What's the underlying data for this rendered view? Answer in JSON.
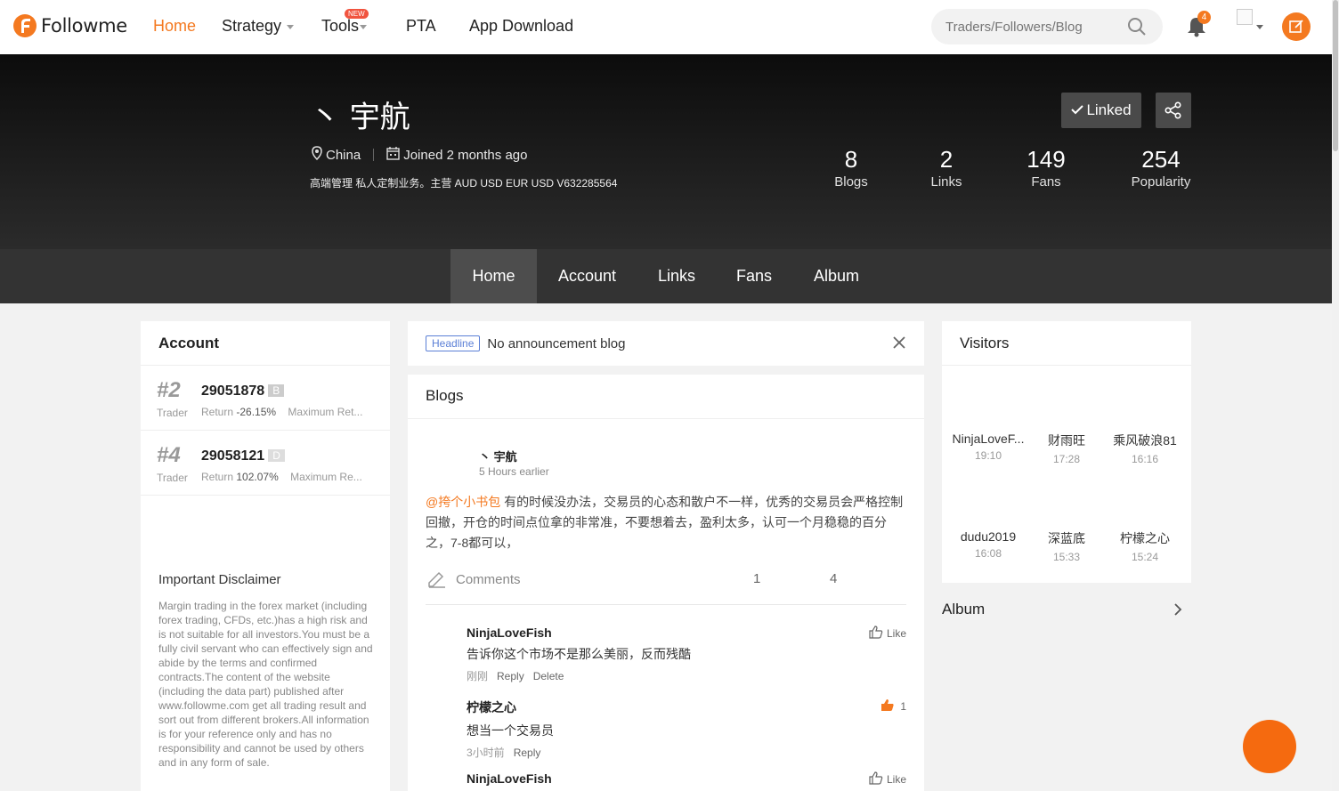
{
  "app": {
    "logo_text": "Followme",
    "brand_color": "#f47920"
  },
  "nav": {
    "items": [
      {
        "label": "Home",
        "active": true
      },
      {
        "label": "Strategy",
        "dropdown": true
      },
      {
        "label": "Tools",
        "dropdown": true,
        "badge": "NEW"
      },
      {
        "label": "PTA"
      },
      {
        "label": "App Download"
      }
    ],
    "search_placeholder": "Traders/Followers/Blog",
    "notification_count": "4"
  },
  "profile": {
    "name": "丶 宇航",
    "location": "China",
    "joined": "Joined 2 months ago",
    "bio": "高端管理 私人定制业务。主营 AUD USD EUR USD V632285564",
    "linked_label": "Linked",
    "stats": [
      {
        "value": "8",
        "label": "Blogs"
      },
      {
        "value": "2",
        "label": "Links"
      },
      {
        "value": "149",
        "label": "Fans"
      },
      {
        "value": "254",
        "label": "Popularity"
      }
    ]
  },
  "tabs": [
    "Home",
    "Account",
    "Links",
    "Fans",
    "Album"
  ],
  "account": {
    "title": "Account",
    "rows": [
      {
        "rank": "#2",
        "number": "29051878",
        "badge": "B",
        "type": "Trader",
        "return_label": "Return",
        "return_value": "-26.15%",
        "extra": "Maximum Ret..."
      },
      {
        "rank": "#4",
        "number": "29058121",
        "badge": "D",
        "type": "Trader",
        "return_label": "Return",
        "return_value": "102.07%",
        "extra": "Maximum Re..."
      }
    ],
    "disclaimer_title": "Important Disclaimer",
    "disclaimer_text": "Margin trading in the forex market (including forex trading, CFDs, etc.)has a high risk and is not suitable for all investors.You must be a fully civil servant who can effectively sign and abide by the terms and confirmed contracts.The content of the website (including the data part) published after www.followme.com get all trading result and sort out from different brokers.All information is for your reference only and has no responsibility and cannot be used by others and in any form of sale."
  },
  "announcement": {
    "tag": "Headline",
    "text": "No announcement blog"
  },
  "blogs": {
    "title": "Blogs",
    "post": {
      "author": "丶 宇航",
      "time": "5 Hours earlier",
      "mention": "@挎个小书包",
      "body": " 有的时候没办法，交易员的心态和散户不一样，优秀的交易员会严格控制回撤，开仓的时间点位拿的非常准，不要想着去，盈利太多，认可一个月稳稳的百分之，7-8都可以，",
      "comments_label": "Comments",
      "count_a": "1",
      "count_b": "4"
    },
    "comments": [
      {
        "name": "NinjaLoveFish",
        "text": "告诉你这个市场不是那么美丽，反而残酷",
        "time": "刚刚",
        "actions": [
          "Reply",
          "Delete"
        ],
        "like": "Like"
      },
      {
        "name": "柠檬之心",
        "text": "想当一个交易员",
        "time": "3小时前",
        "actions": [
          "Reply"
        ],
        "like": "1"
      },
      {
        "name": "NinjaLoveFish",
        "text": "",
        "time": "",
        "actions": [],
        "like": "Like"
      }
    ]
  },
  "visitors": {
    "title": "Visitors",
    "items": [
      {
        "name": "NinjaLoveF...",
        "time": "19:10"
      },
      {
        "name": "财雨旺",
        "time": "17:28"
      },
      {
        "name": "乘风破浪81",
        "time": "16:16"
      },
      {
        "name": "dudu2019",
        "time": "16:08"
      },
      {
        "name": "深蓝底",
        "time": "15:33"
      },
      {
        "name": "柠檬之心",
        "time": "15:24"
      }
    ]
  },
  "album": {
    "title": "Album"
  }
}
